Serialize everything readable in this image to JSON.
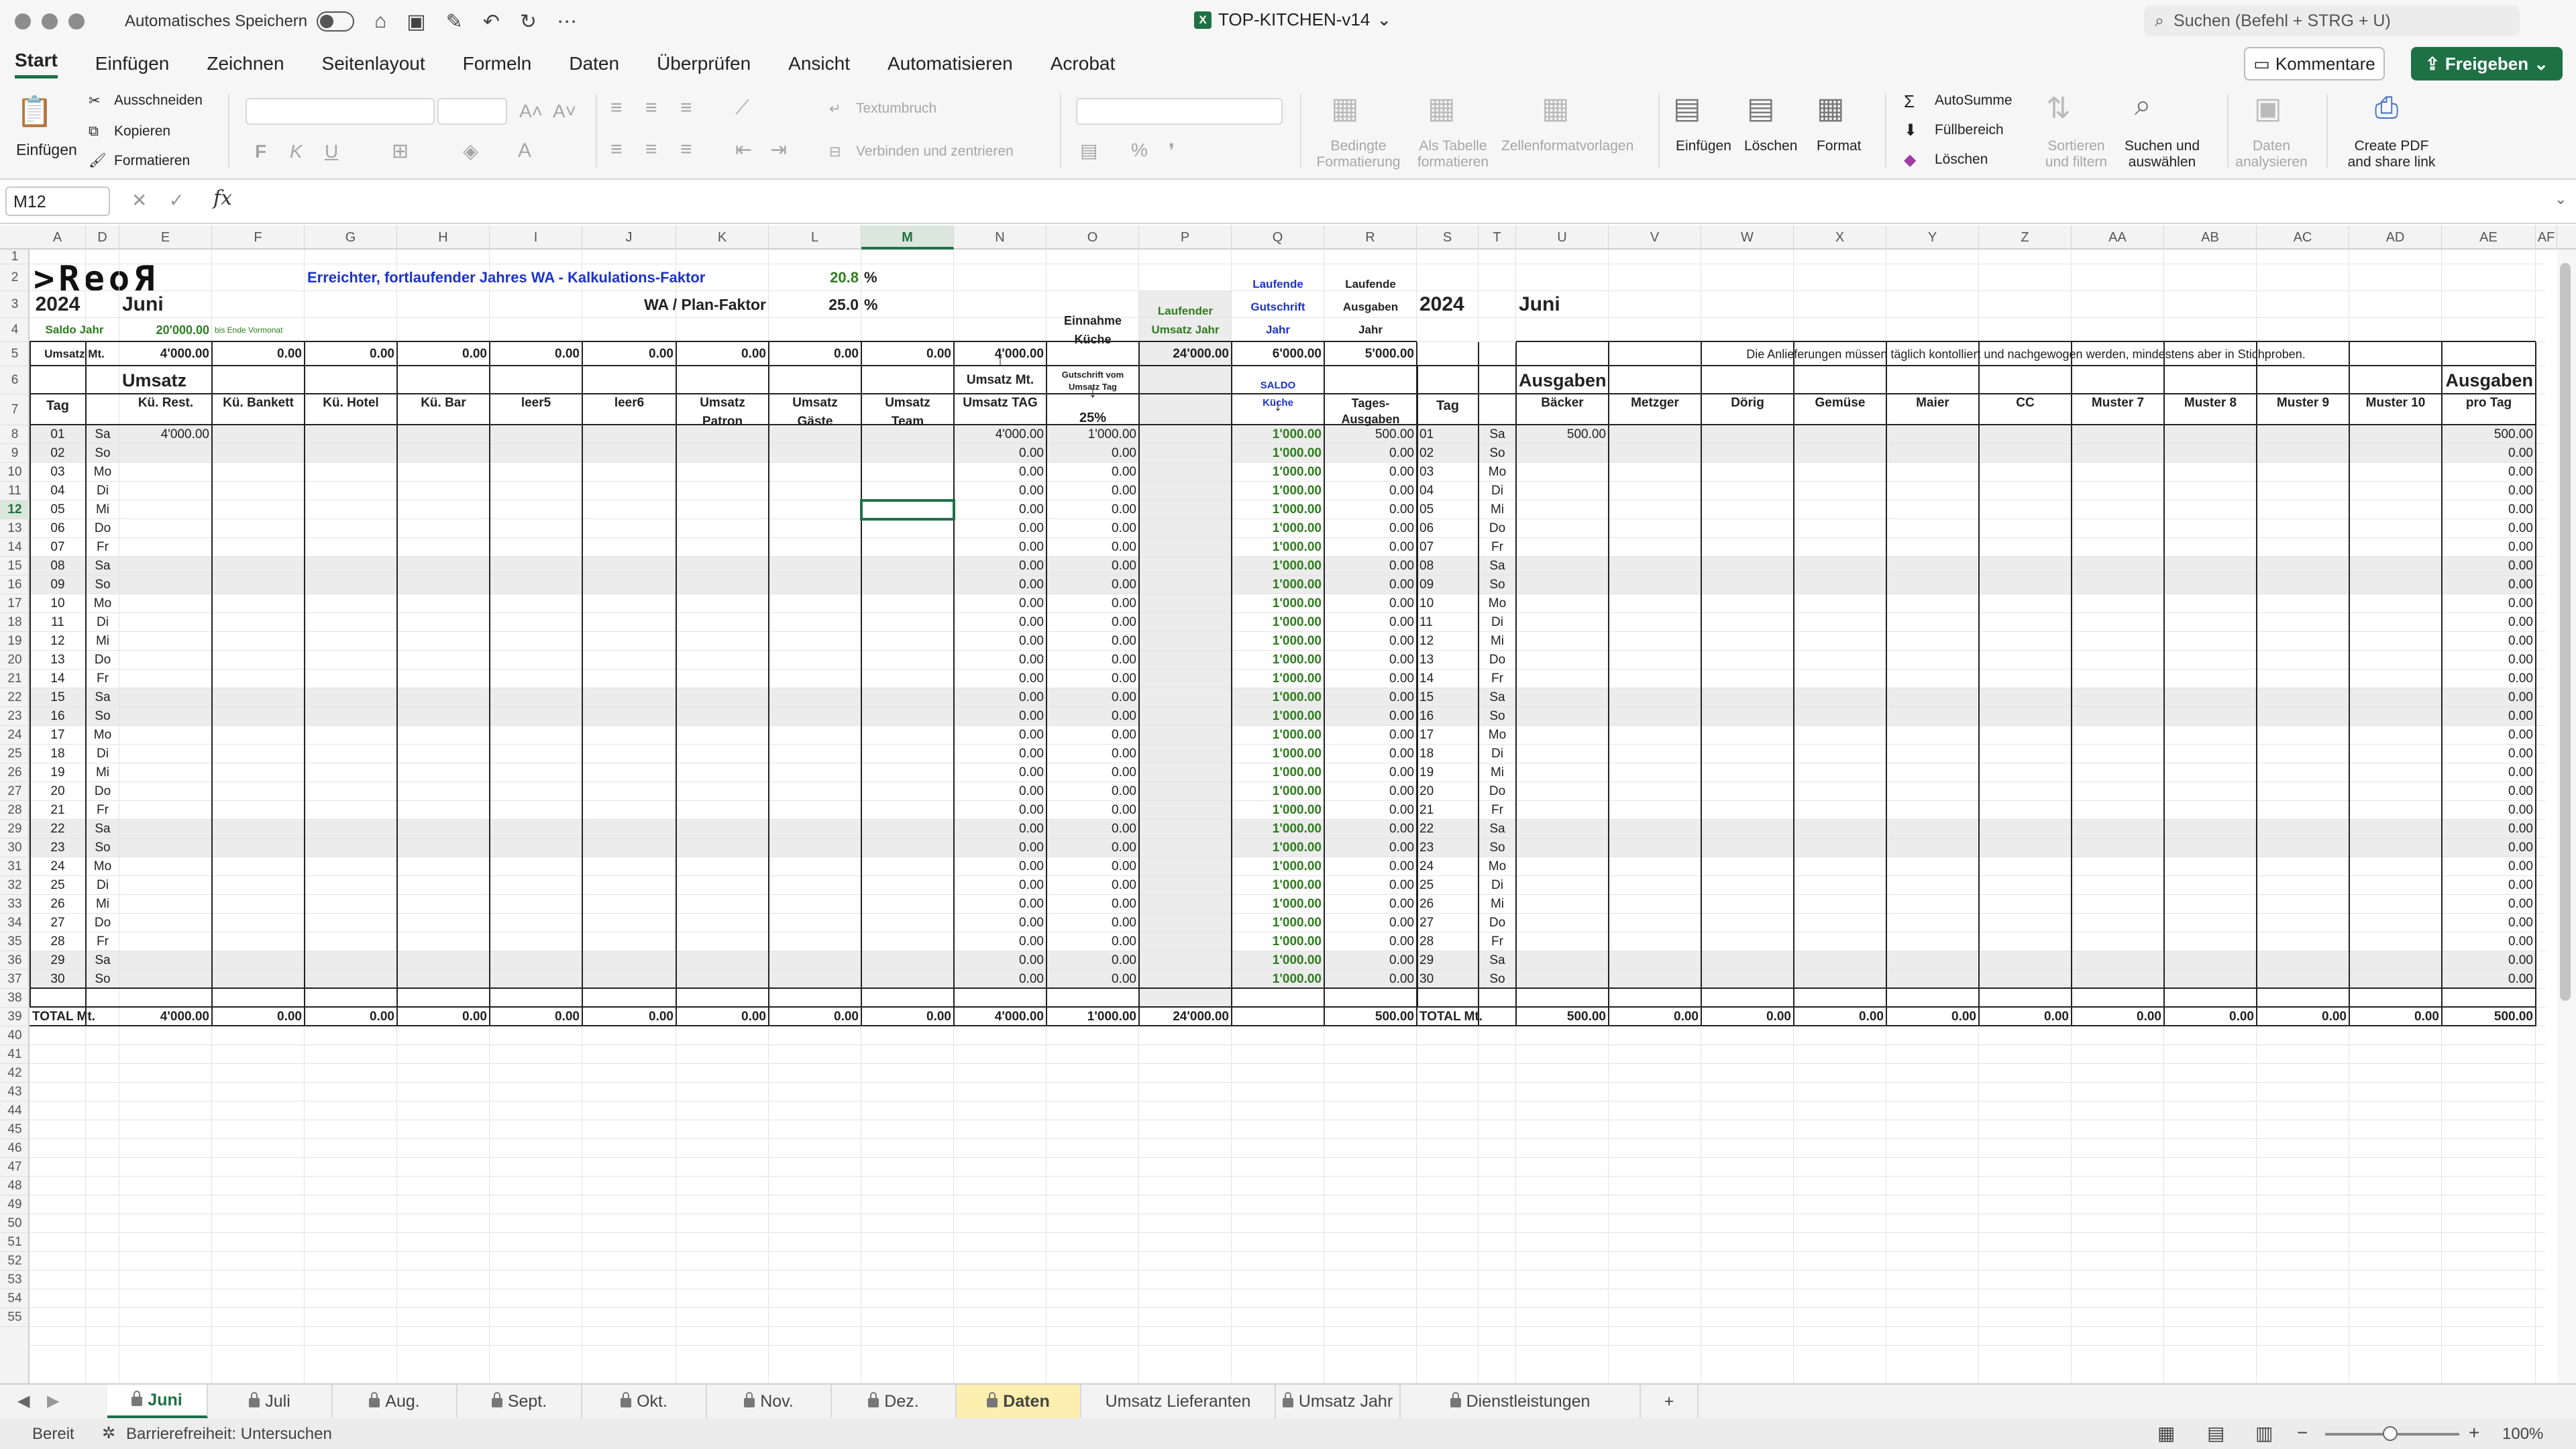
{
  "app": {
    "autosave": "Automatisches Speichern",
    "doc_title": "TOP-KITCHEN-v14",
    "search_placeholder": "Suchen (Befehl + STRG + U)"
  },
  "menu": [
    "Start",
    "Einfügen",
    "Zeichnen",
    "Seitenlayout",
    "Formeln",
    "Daten",
    "Überprüfen",
    "Ansicht",
    "Automatisieren",
    "Acrobat"
  ],
  "buttons": {
    "comments": "Kommentare",
    "share": "Freigeben"
  },
  "ribbon": {
    "paste": "Einfügen",
    "cut": "Ausschneiden",
    "copy": "Kopieren",
    "format_painter": "Formatieren",
    "wrap": "Textumbruch",
    "merge": "Verbinden und zentrieren",
    "cond_format": [
      "Bedingte",
      "Formatierung"
    ],
    "as_table": [
      "Als Tabelle",
      "formatieren"
    ],
    "cell_styles": "Zellenformatvorlagen",
    "insert": "Einfügen",
    "delete": "Löschen",
    "format": "Format",
    "autosum": "AutoSumme",
    "fill": "Füllbereich",
    "clear": "Löschen",
    "sort": [
      "Sortieren",
      "und filtern"
    ],
    "find": [
      "Suchen und",
      "auswählen"
    ],
    "analyze": [
      "Daten",
      "analysieren"
    ],
    "pdf": [
      "Create PDF",
      "and share link"
    ],
    "font_b": "F",
    "font_i": "K",
    "font_u": "U"
  },
  "namebox": "M12",
  "fx": "fx",
  "columns": [
    "A",
    "D",
    "E",
    "F",
    "G",
    "H",
    "I",
    "J",
    "K",
    "L",
    "M",
    "N",
    "O",
    "P",
    "Q",
    "R",
    "S",
    "T",
    "U",
    "V",
    "W",
    "X",
    "Y",
    "Z",
    "AA",
    "AB",
    "AC",
    "AD",
    "AE",
    "AF"
  ],
  "rows_visible": [
    "1",
    "2",
    "3",
    "4",
    "5",
    "6",
    "7",
    "8",
    "9",
    "10",
    "11",
    "12",
    "13",
    "14",
    "15",
    "16",
    "17",
    "18",
    "19",
    "20",
    "21",
    "22",
    "23",
    "24",
    "25",
    "26",
    "27",
    "28",
    "29",
    "30",
    "31",
    "32",
    "33",
    "34",
    "35",
    "36",
    "37",
    "38",
    "39",
    "40",
    "41",
    "42",
    "43",
    "44",
    "45",
    "46",
    "47",
    "48",
    "49",
    "50",
    "51",
    "52",
    "53",
    "54",
    "55"
  ],
  "sheet": {
    "logo": ">ReoЯ",
    "header_line": "Erreichter, fortlaufender Jahres WA - Kalkulations-Faktor",
    "wa_value": "20.8",
    "pct": "%",
    "wa_plan_label": "WA / Plan-Faktor",
    "wa_plan_value": "25.0",
    "year": "2024",
    "month": "Juni",
    "saldo_jahr": "Saldo Jahr",
    "saldo_value": "20'000.00",
    "saldo_note": "bis Ende Vormonat",
    "umsatz_mt_label": "Umsatz Mt.",
    "umsatz_mt_row": [
      "4'000.00",
      "0.00",
      "0.00",
      "0.00",
      "0.00",
      "0.00",
      "0.00",
      "0.00",
      "0.00",
      "4'000.00"
    ],
    "einnahme": [
      "Einnahme",
      "Küche"
    ],
    "laufender_umsatz": [
      "Laufender",
      "Umsatz   Jahr"
    ],
    "laufende_gutschrift": [
      "Laufende",
      "Gutschrift",
      "Jahr"
    ],
    "laufende_ausgaben": [
      "Laufende",
      "Ausgaben",
      "Jahr"
    ],
    "p5": "24'000.00",
    "q5": "6'000.00",
    "r5": "5'000.00",
    "right_year": "2024",
    "right_month": "Juni",
    "notice": "Die Anlieferungen müssen täglich kontolliert und nachgewogen werden, mindestens aber in Stichproben.",
    "umsatz_title": "Umsatz",
    "umsatz_mt_n6": "Umsatz Mt.",
    "gutschrift": [
      "Gutschrift vom",
      "Umsatz Tag"
    ],
    "pct25": "25%",
    "saldo_kueche": [
      "SALDO",
      "Küche"
    ],
    "tages_ausgaben": [
      "Tages-",
      "Ausgaben"
    ],
    "ausgaben_title": "Ausgaben",
    "ausgaben_title_right": "Ausgaben",
    "left_headers": [
      [
        "Kü. Rest."
      ],
      [
        "Kü. Bankett"
      ],
      [
        "Kü. Hotel"
      ],
      [
        "Kü. Bar"
      ],
      [
        "leer5"
      ],
      [
        "leer6"
      ],
      [
        "Umsatz",
        "Patron"
      ],
      [
        "Umsatz",
        "Gäste"
      ],
      [
        "Umsatz",
        "Team"
      ]
    ],
    "umsatz_tag": "Umsatz TAG",
    "tag": "Tag",
    "right_headers": [
      "Bäcker",
      "Metzger",
      "Dörig",
      "Gemüse",
      "Maier",
      "CC",
      "Muster 7",
      "Muster 8",
      "Muster 9",
      "Muster 10"
    ],
    "pro_tag": "pro Tag",
    "days": [
      [
        "01",
        "Sa"
      ],
      [
        "02",
        "So"
      ],
      [
        "03",
        "Mo"
      ],
      [
        "04",
        "Di"
      ],
      [
        "05",
        "Mi"
      ],
      [
        "06",
        "Do"
      ],
      [
        "07",
        "Fr"
      ],
      [
        "08",
        "Sa"
      ],
      [
        "09",
        "So"
      ],
      [
        "10",
        "Mo"
      ],
      [
        "11",
        "Di"
      ],
      [
        "12",
        "Mi"
      ],
      [
        "13",
        "Do"
      ],
      [
        "14",
        "Fr"
      ],
      [
        "15",
        "Sa"
      ],
      [
        "16",
        "So"
      ],
      [
        "17",
        "Mo"
      ],
      [
        "18",
        "Di"
      ],
      [
        "19",
        "Mi"
      ],
      [
        "20",
        "Do"
      ],
      [
        "21",
        "Fr"
      ],
      [
        "22",
        "Sa"
      ],
      [
        "23",
        "So"
      ],
      [
        "24",
        "Mo"
      ],
      [
        "25",
        "Di"
      ],
      [
        "26",
        "Mi"
      ],
      [
        "27",
        "Do"
      ],
      [
        "28",
        "Fr"
      ],
      [
        "29",
        "Sa"
      ],
      [
        "30",
        "So"
      ]
    ],
    "first_day": {
      "kue_rest": "4'000.00",
      "umsatz_tag": "4'000.00",
      "gutschrift": "1'000.00",
      "tages_ausgaben": "500.00",
      "baecker": "500.00",
      "pro_tag": "500.00"
    },
    "zero": "0.00",
    "saldo_daily": "1'000.00",
    "total_label": "TOTAL Mt.",
    "total_left": [
      "4'000.00",
      "0.00",
      "0.00",
      "0.00",
      "0.00",
      "0.00",
      "0.00",
      "0.00",
      "0.00",
      "4'000.00"
    ],
    "total_o": "1'000.00",
    "total_p": "24'000.00",
    "total_r": "500.00",
    "total_right": [
      "500.00",
      "0.00",
      "0.00",
      "0.00",
      "0.00",
      "0.00",
      "0.00",
      "0.00",
      "0.00",
      "0.00",
      "500.00"
    ]
  },
  "tabs": [
    "Juni",
    "Juli",
    "Aug.",
    "Sept.",
    "Okt.",
    "Nov.",
    "Dez.",
    "Daten",
    "Umsatz Lieferanten",
    "Umsatz Jahr",
    "Dienstleistungen",
    "+"
  ],
  "status": {
    "ready": "Bereit",
    "accessibility": "Barrierefreiheit: Untersuchen",
    "zoom": "100%"
  }
}
